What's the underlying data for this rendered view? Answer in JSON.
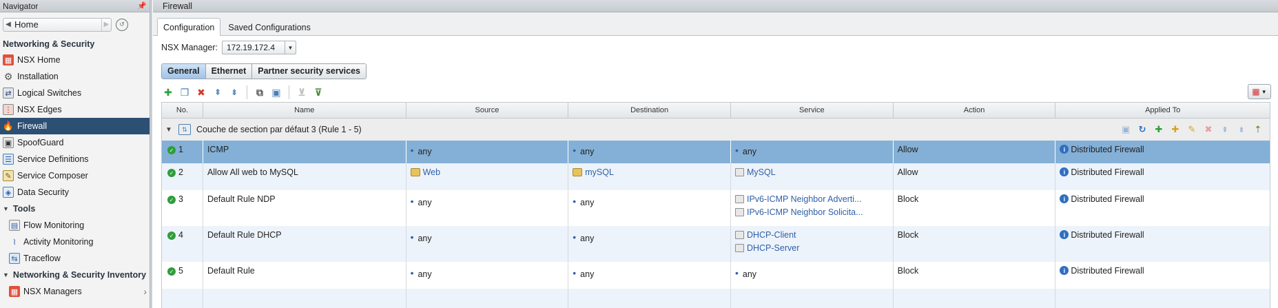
{
  "navigator": {
    "title": "Navigator",
    "home_label": "Home",
    "section_title": "Networking & Security",
    "items": [
      {
        "label": "NSX Home"
      },
      {
        "label": "Installation"
      },
      {
        "label": "Logical Switches"
      },
      {
        "label": "NSX Edges"
      },
      {
        "label": "Firewall"
      },
      {
        "label": "SpoofGuard"
      },
      {
        "label": "Service Definitions"
      },
      {
        "label": "Service Composer"
      },
      {
        "label": "Data Security"
      }
    ],
    "tools_label": "Tools",
    "tools": [
      {
        "label": "Flow Monitoring"
      },
      {
        "label": "Activity Monitoring"
      },
      {
        "label": "Traceflow"
      }
    ],
    "inventory_label": "Networking & Security Inventory",
    "inventory": [
      {
        "label": "NSX Managers"
      }
    ]
  },
  "main": {
    "title": "Firewall",
    "tabs": [
      {
        "label": "Configuration"
      },
      {
        "label": "Saved Configurations"
      }
    ],
    "manager_label": "NSX Manager:",
    "manager_value": "172.19.172.4",
    "segments": [
      {
        "label": "General"
      },
      {
        "label": "Ethernet"
      },
      {
        "label": "Partner security services"
      }
    ]
  },
  "grid": {
    "columns": [
      "No.",
      "Name",
      "Source",
      "Destination",
      "Service",
      "Action",
      "Applied To"
    ],
    "section_title": "Couche de section par défaut 3 (Rule 1 - 5)",
    "rows": [
      {
        "no": "1",
        "name": "ICMP",
        "source": "any",
        "destination": "any",
        "services": [
          "any"
        ],
        "action": "Allow",
        "applied_to": "Distributed Firewall"
      },
      {
        "no": "2",
        "name": "Allow All web to MySQL",
        "source": "Web",
        "destination": "mySQL",
        "services": [
          "MySQL"
        ],
        "action": "Allow",
        "applied_to": "Distributed Firewall"
      },
      {
        "no": "3",
        "name": "Default Rule NDP",
        "source": "any",
        "destination": "any",
        "services": [
          "IPv6-ICMP Neighbor Adverti...",
          "IPv6-ICMP Neighbor Solicita..."
        ],
        "action": "Block",
        "applied_to": "Distributed Firewall"
      },
      {
        "no": "4",
        "name": "Default Rule DHCP",
        "source": "any",
        "destination": "any",
        "services": [
          "DHCP-Client",
          "DHCP-Server"
        ],
        "action": "Block",
        "applied_to": "Distributed Firewall"
      },
      {
        "no": "5",
        "name": "Default Rule",
        "source": "any",
        "destination": "any",
        "services": [
          "any"
        ],
        "action": "Block",
        "applied_to": "Distributed Firewall"
      }
    ]
  },
  "colors": {
    "selected_nav": "#2c4f74",
    "selected_row": "#84b0d7",
    "link": "#2e5fa8",
    "allow_check": "#2e9e3a"
  }
}
